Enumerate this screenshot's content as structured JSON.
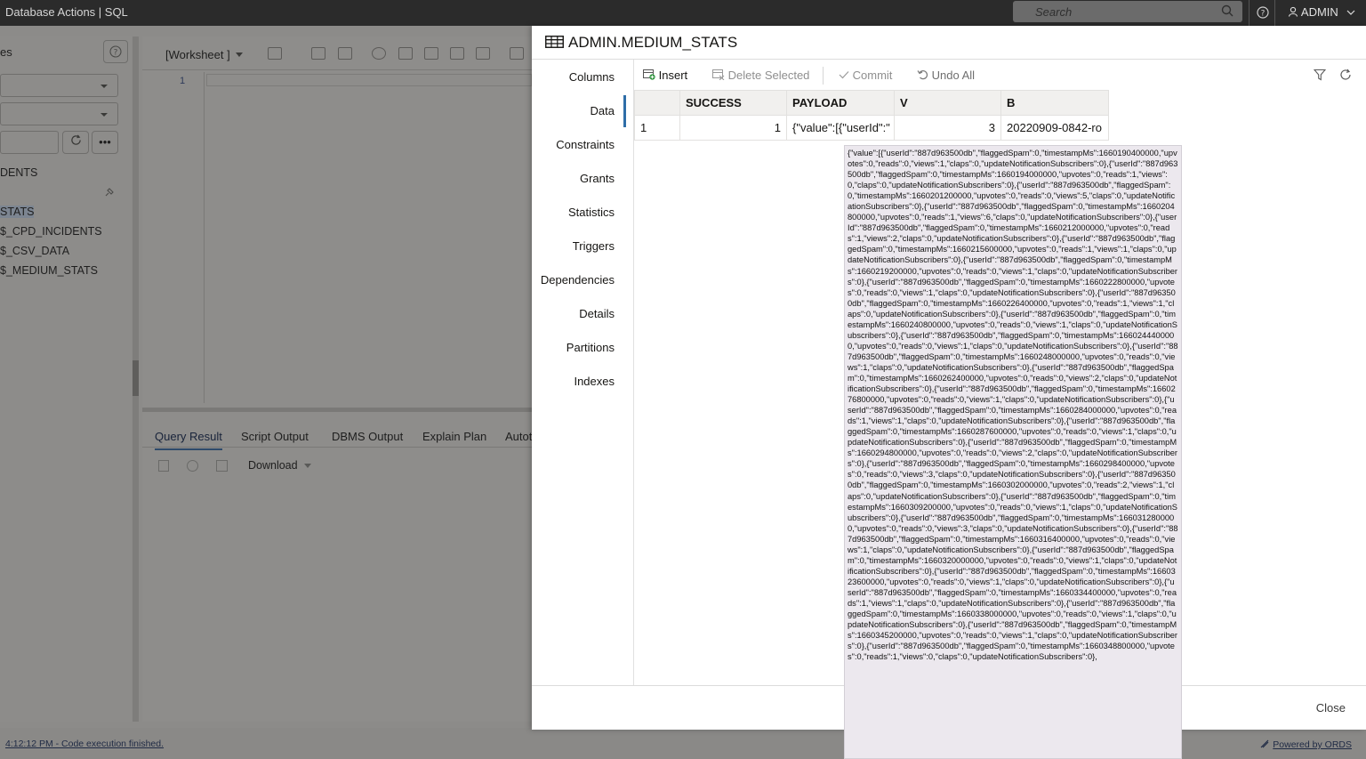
{
  "topbar": {
    "breadcrumb": "Database Actions | SQL",
    "search_placeholder": "Search",
    "user": "ADMIN"
  },
  "left_panel": {
    "title_fragment": "es",
    "tree_items": [
      "DENTS",
      "STATS",
      "$_CPD_INCIDENTS",
      "$_CSV_DATA",
      "$_MEDIUM_STATS"
    ]
  },
  "editor": {
    "worksheet_label": "[Worksheet ]",
    "line_number": "1",
    "result_tabs": [
      "Query Result",
      "Script Output",
      "DBMS Output",
      "Explain Plan",
      "Autot"
    ],
    "download_label": "Download"
  },
  "status": {
    "message": "4:12:12 PM - Code execution finished.",
    "powered_by": "Powered by ORDS"
  },
  "modal": {
    "title": "ADMIN.MEDIUM_STATS",
    "nav": [
      "Columns",
      "Data",
      "Constraints",
      "Grants",
      "Statistics",
      "Triggers",
      "Dependencies",
      "Details",
      "Partitions",
      "Indexes"
    ],
    "active_nav": "Data",
    "toolbar": {
      "insert": "Insert",
      "delete_selected": "Delete Selected",
      "commit": "Commit",
      "undo_all": "Undo All"
    },
    "table": {
      "columns": [
        "SUCCESS",
        "PAYLOAD",
        "V",
        "B"
      ],
      "rows": [
        {
          "rownum": "1",
          "SUCCESS": "1",
          "PAYLOAD": "{\"value\":[{\"userId\":\"",
          "V": "3",
          "B": "20220909-0842-ro"
        }
      ]
    },
    "close_label": "Close"
  },
  "tooltip_text": "{\"value\":[{\"userId\":\"887d963500db\",\"flaggedSpam\":0,\"timestampMs\":1660190400000,\"upvotes\":0,\"reads\":0,\"views\":1,\"claps\":0,\"updateNotificationSubscribers\":0},{\"userId\":\"887d963500db\",\"flaggedSpam\":0,\"timestampMs\":1660194000000,\"upvotes\":0,\"reads\":1,\"views\":0,\"claps\":0,\"updateNotificationSubscribers\":0},{\"userId\":\"887d963500db\",\"flaggedSpam\":0,\"timestampMs\":1660201200000,\"upvotes\":0,\"reads\":0,\"views\":5,\"claps\":0,\"updateNotificationSubscribers\":0},{\"userId\":\"887d963500db\",\"flaggedSpam\":0,\"timestampMs\":1660204800000,\"upvotes\":0,\"reads\":1,\"views\":6,\"claps\":0,\"updateNotificationSubscribers\":0},{\"userId\":\"887d963500db\",\"flaggedSpam\":0,\"timestampMs\":1660212000000,\"upvotes\":0,\"reads\":1,\"views\":2,\"claps\":0,\"updateNotificationSubscribers\":0},{\"userId\":\"887d963500db\",\"flaggedSpam\":0,\"timestampMs\":1660215600000,\"upvotes\":0,\"reads\":1,\"views\":1,\"claps\":0,\"updateNotificationSubscribers\":0},{\"userId\":\"887d963500db\",\"flaggedSpam\":0,\"timestampMs\":1660219200000,\"upvotes\":0,\"reads\":0,\"views\":1,\"claps\":0,\"updateNotificationSubscribers\":0},{\"userId\":\"887d963500db\",\"flaggedSpam\":0,\"timestampMs\":1660222800000,\"upvotes\":0,\"reads\":0,\"views\":1,\"claps\":0,\"updateNotificationSubscribers\":0},{\"userId\":\"887d963500db\",\"flaggedSpam\":0,\"timestampMs\":1660226400000,\"upvotes\":0,\"reads\":1,\"views\":1,\"claps\":0,\"updateNotificationSubscribers\":0},{\"userId\":\"887d963500db\",\"flaggedSpam\":0,\"timestampMs\":1660240800000,\"upvotes\":0,\"reads\":0,\"views\":1,\"claps\":0,\"updateNotificationSubscribers\":0},{\"userId\":\"887d963500db\",\"flaggedSpam\":0,\"timestampMs\":1660244400000,\"upvotes\":0,\"reads\":0,\"views\":1,\"claps\":0,\"updateNotificationSubscribers\":0},{\"userId\":\"887d963500db\",\"flaggedSpam\":0,\"timestampMs\":1660248000000,\"upvotes\":0,\"reads\":0,\"views\":1,\"claps\":0,\"updateNotificationSubscribers\":0},{\"userId\":\"887d963500db\",\"flaggedSpam\":0,\"timestampMs\":1660262400000,\"upvotes\":0,\"reads\":0,\"views\":2,\"claps\":0,\"updateNotificationSubscribers\":0},{\"userId\":\"887d963500db\",\"flaggedSpam\":0,\"timestampMs\":1660276800000,\"upvotes\":0,\"reads\":0,\"views\":1,\"claps\":0,\"updateNotificationSubscribers\":0},{\"userId\":\"887d963500db\",\"flaggedSpam\":0,\"timestampMs\":1660284000000,\"upvotes\":0,\"reads\":1,\"views\":1,\"claps\":0,\"updateNotificationSubscribers\":0},{\"userId\":\"887d963500db\",\"flaggedSpam\":0,\"timestampMs\":1660287600000,\"upvotes\":0,\"reads\":0,\"views\":1,\"claps\":0,\"updateNotificationSubscribers\":0},{\"userId\":\"887d963500db\",\"flaggedSpam\":0,\"timestampMs\":1660294800000,\"upvotes\":0,\"reads\":0,\"views\":2,\"claps\":0,\"updateNotificationSubscribers\":0},{\"userId\":\"887d963500db\",\"flaggedSpam\":0,\"timestampMs\":1660298400000,\"upvotes\":0,\"reads\":0,\"views\":3,\"claps\":0,\"updateNotificationSubscribers\":0},{\"userId\":\"887d963500db\",\"flaggedSpam\":0,\"timestampMs\":1660302000000,\"upvotes\":0,\"reads\":2,\"views\":1,\"claps\":0,\"updateNotificationSubscribers\":0},{\"userId\":\"887d963500db\",\"flaggedSpam\":0,\"timestampMs\":1660309200000,\"upvotes\":0,\"reads\":0,\"views\":1,\"claps\":0,\"updateNotificationSubscribers\":0},{\"userId\":\"887d963500db\",\"flaggedSpam\":0,\"timestampMs\":1660312800000,\"upvotes\":0,\"reads\":0,\"views\":3,\"claps\":0,\"updateNotificationSubscribers\":0},{\"userId\":\"887d963500db\",\"flaggedSpam\":0,\"timestampMs\":1660316400000,\"upvotes\":0,\"reads\":0,\"views\":1,\"claps\":0,\"updateNotificationSubscribers\":0},{\"userId\":\"887d963500db\",\"flaggedSpam\":0,\"timestampMs\":1660320000000,\"upvotes\":0,\"reads\":0,\"views\":1,\"claps\":0,\"updateNotificationSubscribers\":0},{\"userId\":\"887d963500db\",\"flaggedSpam\":0,\"timestampMs\":1660323600000,\"upvotes\":0,\"reads\":0,\"views\":1,\"claps\":0,\"updateNotificationSubscribers\":0},{\"userId\":\"887d963500db\",\"flaggedSpam\":0,\"timestampMs\":1660334400000,\"upvotes\":0,\"reads\":1,\"views\":1,\"claps\":0,\"updateNotificationSubscribers\":0},{\"userId\":\"887d963500db\",\"flaggedSpam\":0,\"timestampMs\":1660338000000,\"upvotes\":0,\"reads\":0,\"views\":1,\"claps\":0,\"updateNotificationSubscribers\":0},{\"userId\":\"887d963500db\",\"flaggedSpam\":0,\"timestampMs\":1660345200000,\"upvotes\":0,\"reads\":0,\"views\":1,\"claps\":0,\"updateNotificationSubscribers\":0},{\"userId\":\"887d963500db\",\"flaggedSpam\":0,\"timestampMs\":1660348800000,\"upvotes\":0,\"reads\":1,\"views\":0,\"claps\":0,\"updateNotificationSubscribers\":0},"
}
